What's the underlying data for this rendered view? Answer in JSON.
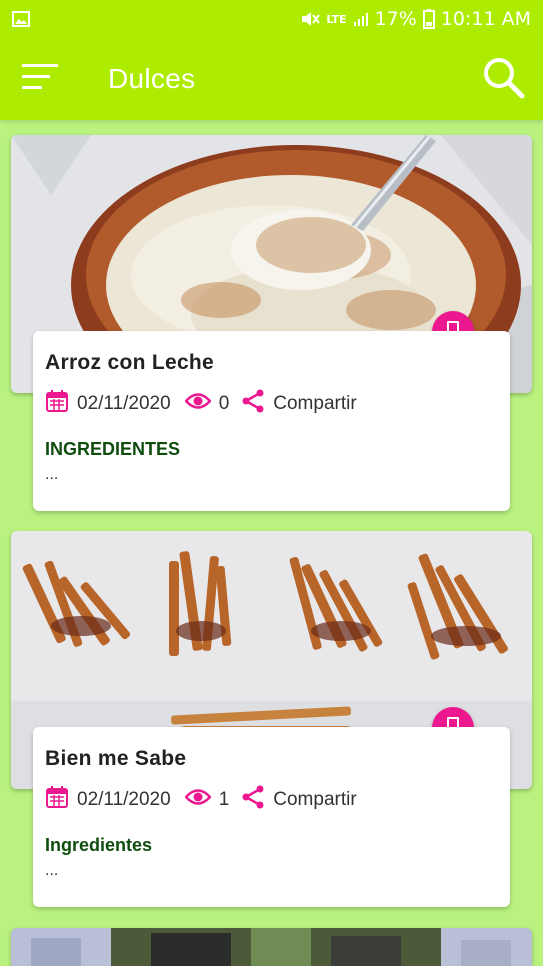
{
  "status_bar": {
    "signal_label": "LTE",
    "battery": "17%",
    "time": "10:11 AM",
    "icons": [
      "gallery-icon",
      "mute-icon",
      "signal-icon",
      "battery-icon"
    ]
  },
  "app_bar": {
    "title": "Dulces",
    "menu_icon": "menu-icon",
    "search_icon": "search-icon"
  },
  "theme": {
    "app_bar_color": "#adeb00",
    "background_color": "#b9f27f",
    "accent_color": "#ec1890",
    "ingredients_color": "#0f4d0f"
  },
  "cards": [
    {
      "title": "Arroz con Leche",
      "date": "02/11/2020",
      "views": "0",
      "share_label": "Compartir",
      "ingredients_label": "INGREDIENTES",
      "ingredients_text": "..."
    },
    {
      "title": "Bien me Sabe",
      "date": "02/11/2020",
      "views": "1",
      "share_label": "Compartir",
      "ingredients_label": "Ingredientes",
      "ingredients_text": "..."
    }
  ]
}
